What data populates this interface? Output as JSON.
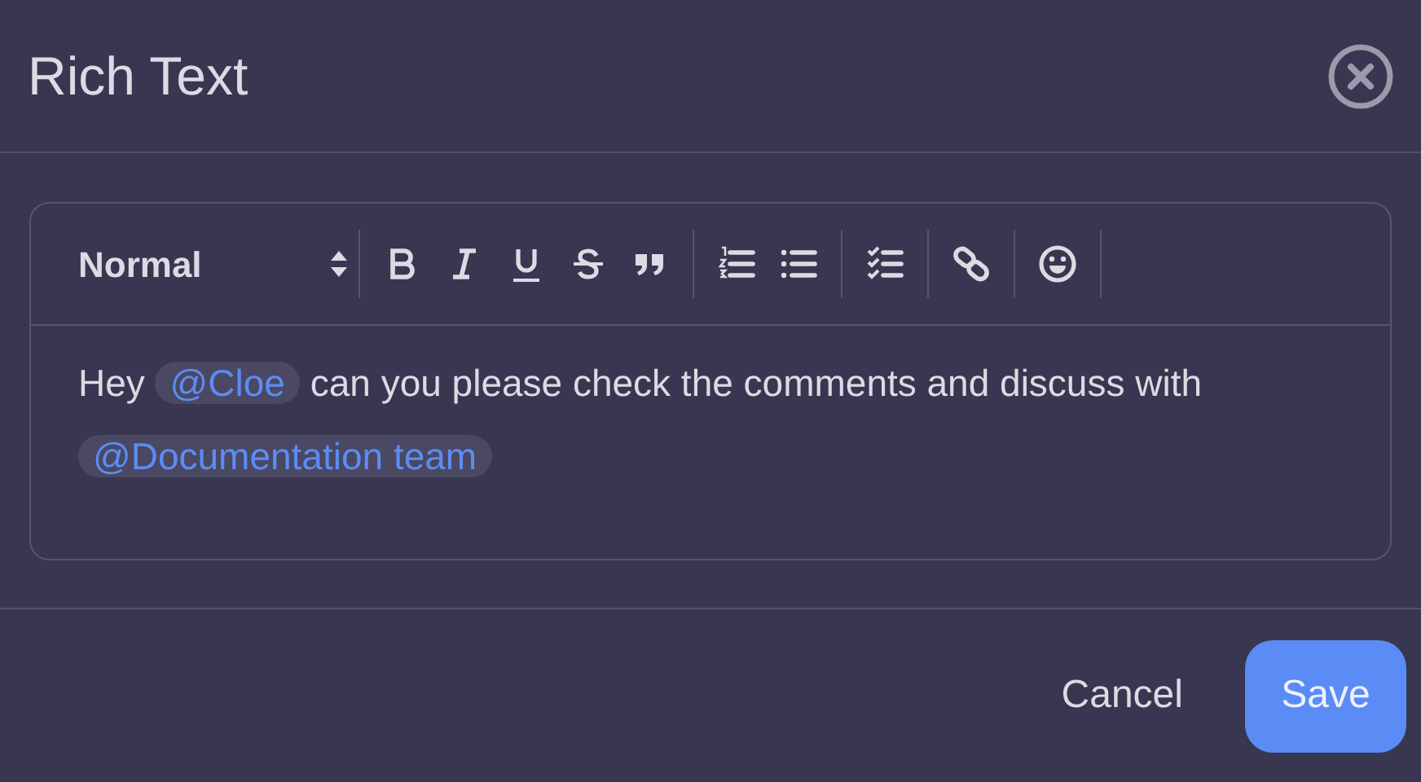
{
  "dialog": {
    "title": "Rich Text"
  },
  "toolbar": {
    "format_select": {
      "value": "Normal"
    },
    "groups": [
      [
        {
          "kind": "bold"
        },
        {
          "kind": "italic"
        },
        {
          "kind": "underline"
        },
        {
          "kind": "strike"
        },
        {
          "kind": "quote"
        }
      ],
      [
        {
          "kind": "ordered-list"
        },
        {
          "kind": "bullet-list"
        }
      ],
      [
        {
          "kind": "check-list"
        }
      ],
      [
        {
          "kind": "link"
        }
      ],
      [
        {
          "kind": "emoji"
        }
      ]
    ]
  },
  "content": [
    {
      "kind": "text",
      "text": "Hey"
    },
    {
      "kind": "mention",
      "text": "@Cloe"
    },
    {
      "kind": "text",
      "text": "can you please check the comments and discuss with"
    },
    {
      "kind": "mention",
      "text": "@Documentation team"
    }
  ],
  "buttons": [
    {
      "kind": "secondary",
      "label": "Cancel"
    },
    {
      "kind": "primary",
      "label": "Save"
    }
  ]
}
